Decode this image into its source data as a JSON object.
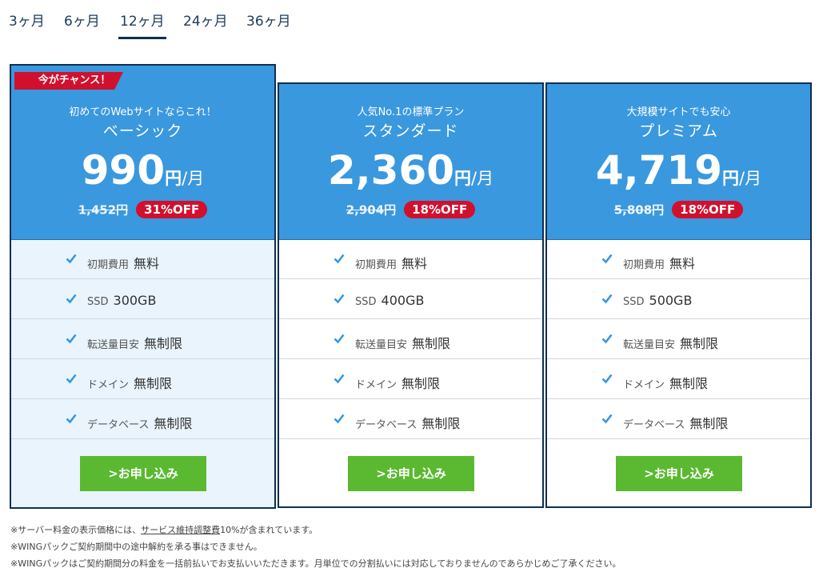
{
  "tabs": [
    {
      "label": "3ヶ月",
      "active": false
    },
    {
      "label": "6ヶ月",
      "active": false
    },
    {
      "label": "12ヶ月",
      "active": true
    },
    {
      "label": "24ヶ月",
      "active": false
    },
    {
      "label": "36ヶ月",
      "active": false
    }
  ],
  "badge_chance": "今がチャンス！",
  "per_unit": "/月",
  "yen": "円",
  "plans": [
    {
      "tagline": "初めてのWebサイトならこれ！",
      "name": "ベーシック",
      "price": "990",
      "original": "1,452円",
      "discount": "31%OFF",
      "features": [
        {
          "label": "初期費用",
          "value": "無料"
        },
        {
          "label": "SSD",
          "value": "300GB"
        },
        {
          "label": "転送量目安",
          "value": "無制限"
        },
        {
          "label": "ドメイン",
          "value": "無制限"
        },
        {
          "label": "データベース",
          "value": "無制限"
        }
      ],
      "cta": "お申し込み"
    },
    {
      "tagline": "人気No.1の標準プラン",
      "name": "スタンダード",
      "price": "2,360",
      "original": "2,904円",
      "discount": "18%OFF",
      "features": [
        {
          "label": "初期費用",
          "value": "無料"
        },
        {
          "label": "SSD",
          "value": "400GB"
        },
        {
          "label": "転送量目安",
          "value": "無制限"
        },
        {
          "label": "ドメイン",
          "value": "無制限"
        },
        {
          "label": "データベース",
          "value": "無制限"
        }
      ],
      "cta": "お申し込み"
    },
    {
      "tagline": "大規模サイトでも安心",
      "name": "プレミアム",
      "price": "4,719",
      "original": "5,808円",
      "discount": "18%OFF",
      "features": [
        {
          "label": "初期費用",
          "value": "無料"
        },
        {
          "label": "SSD",
          "value": "500GB"
        },
        {
          "label": "転送量目安",
          "value": "無制限"
        },
        {
          "label": "ドメイン",
          "value": "無制限"
        },
        {
          "label": "データベース",
          "value": "無制限"
        }
      ],
      "cta": "お申し込み"
    }
  ],
  "notes": {
    "line1_prefix": "※サーバー料金の表示価格には、",
    "line1_link": "サービス維持調整費",
    "line1_suffix": "10%が含まれています。",
    "line2": "※WINGパックご契約期間中の途中解約を承る事はできません。",
    "line3": "※WINGパックはご契約期間分の料金を一括前払いでお支払いいただきます。月単位での分割払いには対応しておりませんのであらかじめご了承ください。"
  },
  "colors": {
    "header_blue": "#3a98de",
    "border_navy": "#0e2f52",
    "badge_red": "#d1102e",
    "cta_green": "#5ab930",
    "check_blue": "#3a98de"
  },
  "icons": {
    "check": "check-icon",
    "chevron": "chevron-right-icon"
  }
}
